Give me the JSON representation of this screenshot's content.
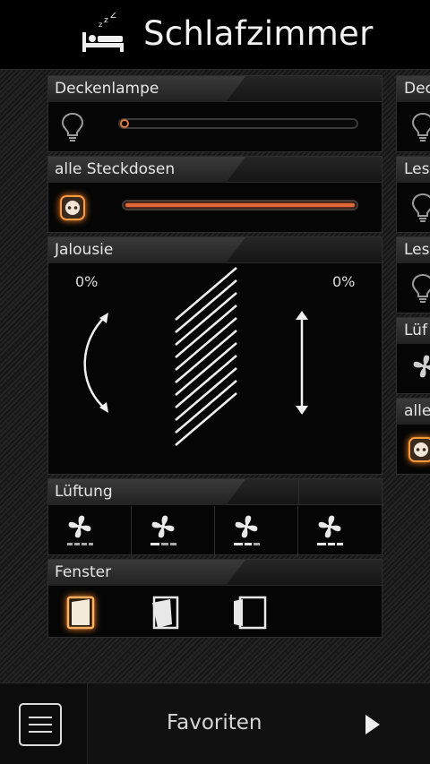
{
  "header": {
    "title": "Schlafzimmer",
    "icon": "sleeping-bed-icon"
  },
  "panels": {
    "deckenlampe": {
      "label": "Deckenlampe",
      "icon": "light-bulb-icon",
      "level": 0.0
    },
    "steckdosen": {
      "label": "alle Steckdosen",
      "icon": "power-socket-icon",
      "level": 1.0,
      "state": "on"
    },
    "jalousie": {
      "label": "Jalousie",
      "angle_value": "0%",
      "position_value": "0%",
      "icons": [
        "tilt-arc-arrow-icon",
        "blinds-slats-icon",
        "vertical-double-arrow-icon"
      ]
    },
    "lueftung": {
      "label": "Lüftung",
      "fan_count": 4,
      "icon": "fan-icon"
    },
    "fenster": {
      "label": "Fenster",
      "icons": [
        "window-closed-icon",
        "window-tilted-icon",
        "window-open-icon"
      ],
      "active_index": 0
    }
  },
  "side_panels": [
    {
      "label": "Dec",
      "icon": "light-bulb-icon"
    },
    {
      "label": "Les",
      "icon": "light-bulb-icon"
    },
    {
      "label": "Les",
      "icon": "light-bulb-icon"
    },
    {
      "label": "Lüf",
      "icon": "fan-icon"
    },
    {
      "label": "alle",
      "icon": "power-socket-icon"
    }
  ],
  "footer": {
    "title": "Favoriten",
    "menu_icon": "hamburger-menu-icon",
    "next_icon": "play-arrow-icon"
  },
  "colors": {
    "accent": "#e2683a",
    "glow": "#ff8a2a",
    "background": "#000000"
  }
}
